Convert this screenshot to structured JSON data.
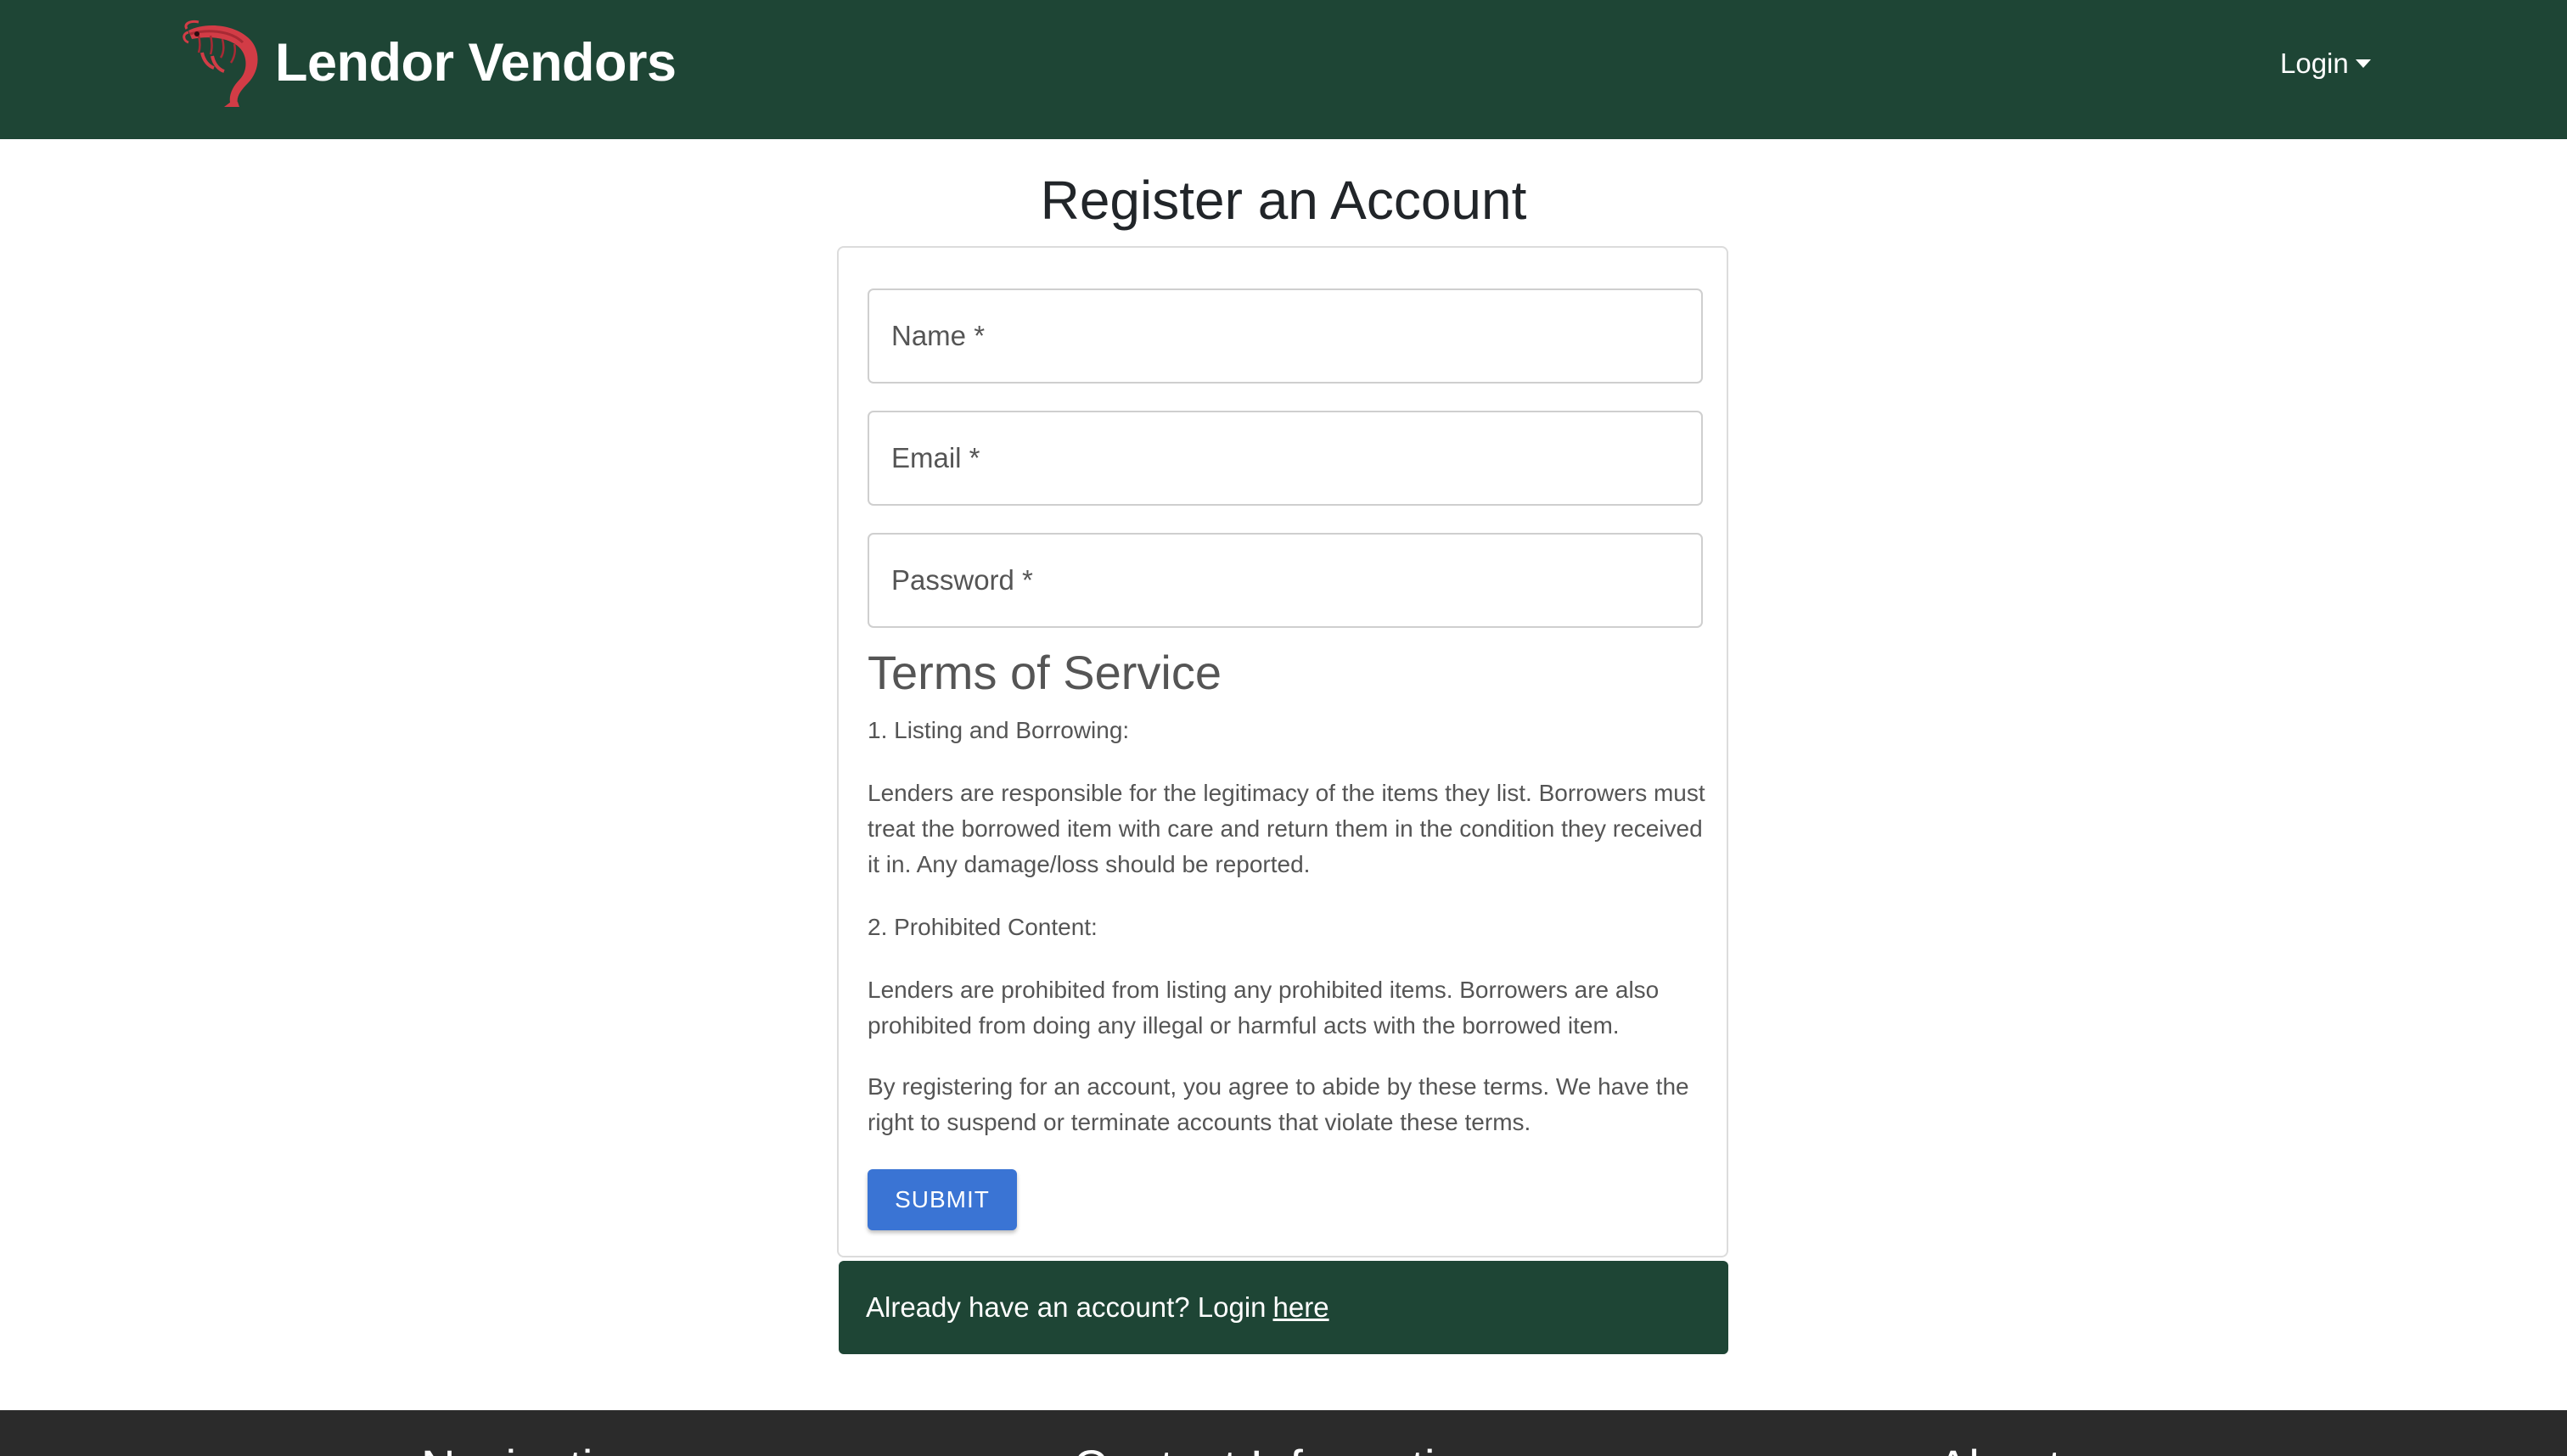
{
  "navbar": {
    "brand_name": "Lendor Vendors",
    "logo_icon": "shrimp-icon",
    "login_label": "Login",
    "background_color": "#1e4535"
  },
  "page": {
    "title": "Register an Account"
  },
  "form": {
    "name_placeholder": "Name *",
    "email_placeholder": "Email *",
    "password_placeholder": "Password *",
    "submit_label": "SUBMIT",
    "submit_color": "#3a74d4"
  },
  "terms": {
    "title": "Terms of Service",
    "section1_heading": "1. Listing and Borrowing:",
    "section1_body": "Lenders are responsible for the legitimacy of the items they list. Borrowers must treat the borrowed item with care and return them in the condition they received it in. Any damage/loss should be reported.",
    "section2_heading": "2. Prohibited Content:",
    "section2_body": "Lenders are prohibited from listing any prohibited items. Borrowers are also prohibited from doing any illegal or harmful acts with the borrowed item.",
    "agreement": "By registering for an account, you agree to abide by these terms. We have the right to suspend or terminate accounts that violate these terms."
  },
  "login_prompt": {
    "text": "Already have an account? Login",
    "link_label": "here"
  },
  "footer": {
    "navigation_heading": "Navigation",
    "contact_heading": "Contact Information",
    "about_heading": "About"
  }
}
